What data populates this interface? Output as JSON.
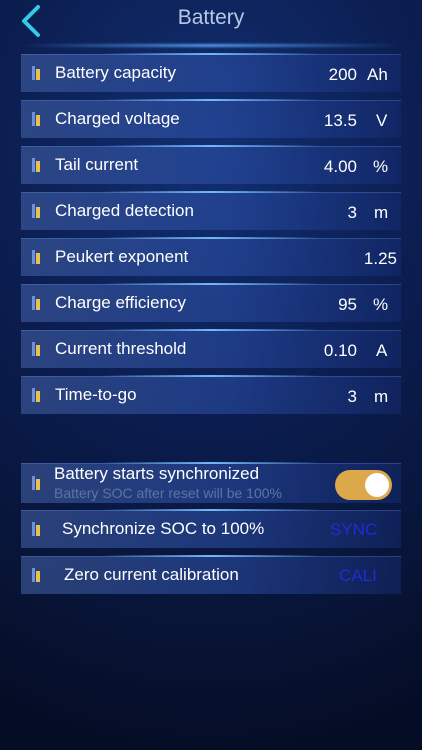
{
  "header": {
    "title": "Battery",
    "back_icon": "chevron-left-icon",
    "accent_color": "#35c9e6"
  },
  "settings": [
    {
      "label": "Battery capacity",
      "value": "200",
      "unit": "Ah"
    },
    {
      "label": "Charged voltage",
      "value": "13.5",
      "unit": "V"
    },
    {
      "label": "Tail current",
      "value": "4.00",
      "unit": "%"
    },
    {
      "label": "Charged detection",
      "value": "3",
      "unit": "m"
    },
    {
      "label": "Peukert exponent",
      "value": "1.25",
      "unit": ""
    },
    {
      "label": "Charge efficiency",
      "value": "95",
      "unit": "%"
    },
    {
      "label": "Current threshold",
      "value": "0.10",
      "unit": "A"
    },
    {
      "label": "Time-to-go",
      "value": "3",
      "unit": "m"
    }
  ],
  "sync_toggle": {
    "label": "Battery starts synchronized",
    "sublabel": "Battery SOC after reset will be 100%",
    "on": true,
    "color": "#dca84a"
  },
  "actions": [
    {
      "label": "Synchronize SOC to 100%",
      "action": "SYNC"
    },
    {
      "label": "Zero current calibration",
      "action": "CALI"
    }
  ]
}
